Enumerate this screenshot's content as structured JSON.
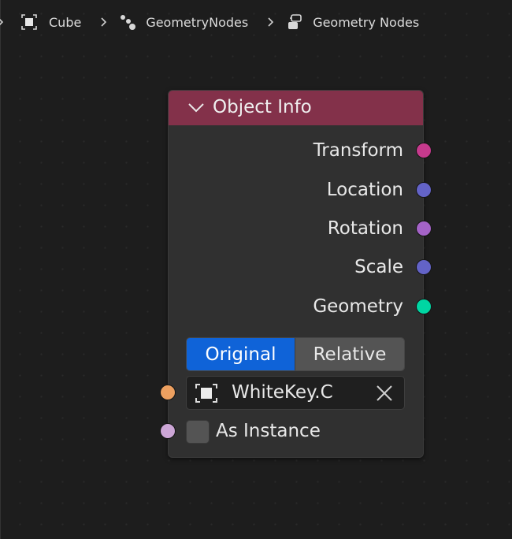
{
  "breadcrumb": {
    "items": [
      "Cube",
      "GeometryNodes",
      "Geometry Nodes"
    ]
  },
  "node": {
    "title": "Object Info",
    "header_color": "#83314a",
    "outputs": [
      {
        "label": "Transform",
        "color": "#c63a8d"
      },
      {
        "label": "Location",
        "color": "#6363c7"
      },
      {
        "label": "Rotation",
        "color": "#a463c7"
      },
      {
        "label": "Scale",
        "color": "#6363c7"
      },
      {
        "label": "Geometry",
        "color": "#00d6a3"
      }
    ],
    "transform_space": {
      "options": [
        "Original",
        "Relative"
      ],
      "selected": "Original"
    },
    "object_field": {
      "value": "WhiteKey.C",
      "socket_color": "#eda060"
    },
    "as_instance": {
      "label": "As Instance",
      "checked": false,
      "socket_color": "#cca6d6"
    }
  }
}
